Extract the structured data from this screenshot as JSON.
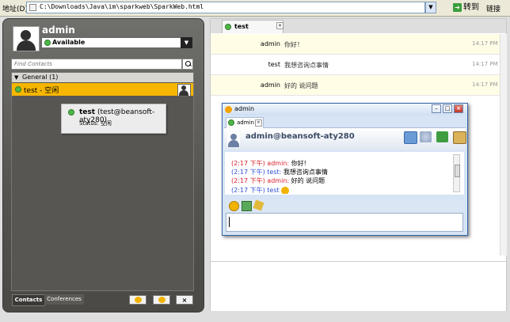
{
  "browser": {
    "address_label": "地址(D)",
    "url": "C:\\Downloads\\Java\\im\\sparkweb\\SparkWeb.html",
    "go_label": "转到",
    "links_label": "链接"
  },
  "roster": {
    "username": "admin",
    "status": "Available",
    "search_placeholder": "Find Contacts",
    "group_name": "General (1)",
    "contact_name": "test - 空闲",
    "tooltip": {
      "name": "test",
      "jid": "(test@beansoft-aty280)",
      "status_label": "Status:",
      "status_value": "空闲"
    },
    "tabs": [
      "Contacts",
      "Conferences"
    ],
    "bottom_buttons": [
      "add-contact",
      "add-conference",
      "remove"
    ],
    "remove_label": "×"
  },
  "chat": {
    "tab_label": "test",
    "messages": [
      {
        "from": "admin",
        "text": "你好！",
        "time": "14:17 PM"
      },
      {
        "from": "test",
        "text": "我想咨询点事情",
        "time": "14:17 PM"
      },
      {
        "from": "admin",
        "text": "好的 说问题",
        "time": "14:17 PM"
      }
    ]
  },
  "popup": {
    "title": "admin",
    "tab_label": "admin",
    "jid": "admin@beansoft-aty280",
    "lines": [
      {
        "time": "(2:17 下午)",
        "from": "admin:",
        "text": "你好!",
        "color": "red"
      },
      {
        "time": "(2:17 下午)",
        "from": "test:",
        "text": "我想咨询点事情",
        "color": "blue"
      },
      {
        "time": "(2:17 下午)",
        "from": "admin:",
        "text": "好的 说问题",
        "color": "red"
      },
      {
        "time": "(2:17 下午)",
        "from": "test",
        "text": "",
        "color": "blue"
      }
    ]
  },
  "colors": {
    "accent_yellow": "#f6b600",
    "online_green": "#4fb848",
    "admin_red": "#d8202a",
    "test_blue": "#2b4fd9"
  }
}
